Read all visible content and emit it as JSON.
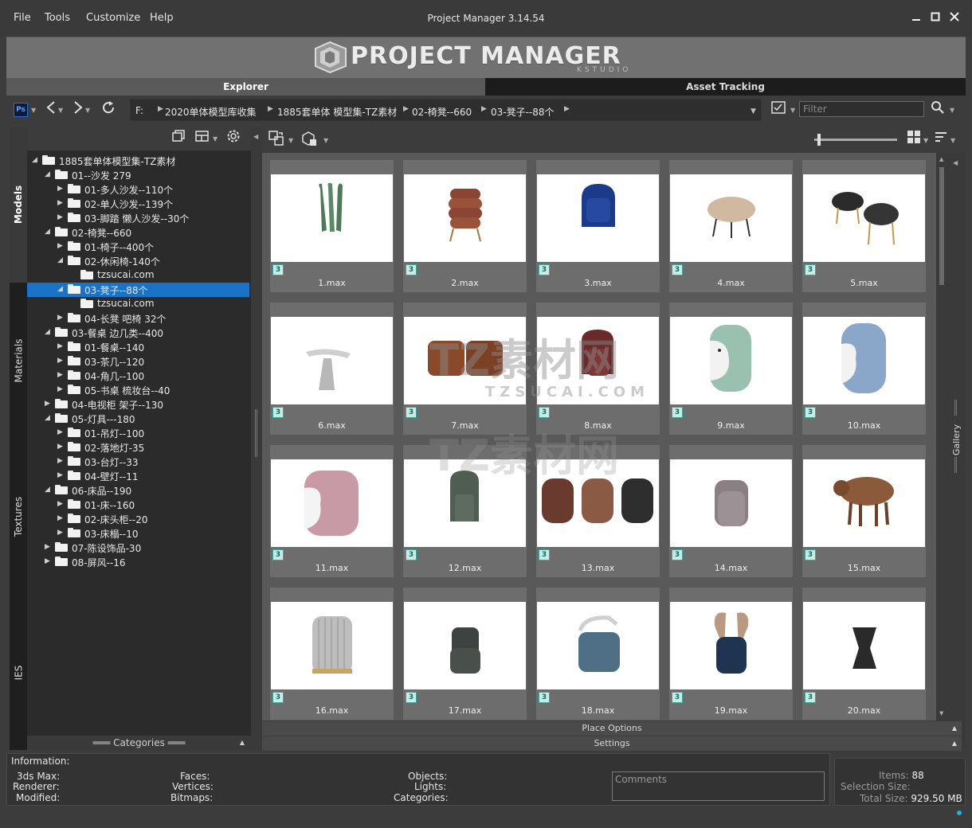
{
  "menu": [
    "File",
    "Tools",
    "Customize",
    "Help"
  ],
  "window": {
    "title": "Project Manager 3.14.54"
  },
  "banner": {
    "title": "PROJECT MANAGER",
    "subtitle": "KSTUDIO"
  },
  "tabs": {
    "explorer": "Explorer",
    "asset_tracking": "Asset Tracking"
  },
  "toolbar": {
    "ps_badge": "Ps",
    "breadcrumb": [
      "F:",
      "2020单体模型库收集",
      "1885套单体 模型集-TZ素材",
      "02-椅凳--660",
      "03-凳子--88个"
    ],
    "filter_placeholder": "Filter"
  },
  "left_tabs": [
    "Models",
    "Materials",
    "Textures",
    "IES"
  ],
  "tree": [
    {
      "label": "1885套单体模型集-TZ素材",
      "level": 0,
      "expanded": true,
      "has_children": true
    },
    {
      "label": "01--沙发 279",
      "level": 1,
      "expanded": true,
      "has_children": true
    },
    {
      "label": "01-多人沙发--110个",
      "level": 2,
      "expanded": false,
      "has_children": true
    },
    {
      "label": "02-单人沙发--139个",
      "level": 2,
      "expanded": false,
      "has_children": true
    },
    {
      "label": "03-脚踏 懒人沙发--30个",
      "level": 2,
      "expanded": false,
      "has_children": true
    },
    {
      "label": "02-椅凳--660",
      "level": 1,
      "expanded": true,
      "has_children": true
    },
    {
      "label": "01-椅子--400个",
      "level": 2,
      "expanded": false,
      "has_children": true
    },
    {
      "label": "02-休闲椅-140个",
      "level": 2,
      "expanded": true,
      "has_children": true
    },
    {
      "label": "tzsucai.com",
      "level": 3,
      "expanded": false,
      "has_children": false
    },
    {
      "label": "03-凳子--88个",
      "level": 2,
      "expanded": true,
      "has_children": true,
      "selected": true
    },
    {
      "label": "tzsucai.com",
      "level": 3,
      "expanded": false,
      "has_children": false
    },
    {
      "label": "04-长凳 吧椅 32个",
      "level": 2,
      "expanded": false,
      "has_children": true
    },
    {
      "label": "03-餐桌 边几类--400",
      "level": 1,
      "expanded": true,
      "has_children": true
    },
    {
      "label": "01-餐桌--140",
      "level": 2,
      "expanded": false,
      "has_children": true
    },
    {
      "label": "03-茶几--120",
      "level": 2,
      "expanded": false,
      "has_children": true
    },
    {
      "label": "04-角几--100",
      "level": 2,
      "expanded": false,
      "has_children": true
    },
    {
      "label": "05-书桌 梳妆台--40",
      "level": 2,
      "expanded": false,
      "has_children": true
    },
    {
      "label": "04-电视柜 架子--130",
      "level": 1,
      "expanded": false,
      "has_children": true
    },
    {
      "label": "05-灯具---180",
      "level": 1,
      "expanded": true,
      "has_children": true
    },
    {
      "label": "01-吊灯--100",
      "level": 2,
      "expanded": false,
      "has_children": true
    },
    {
      "label": "02-落地灯-35",
      "level": 2,
      "expanded": false,
      "has_children": true
    },
    {
      "label": "03-台灯--33",
      "level": 2,
      "expanded": false,
      "has_children": true
    },
    {
      "label": "04-壁灯--11",
      "level": 2,
      "expanded": false,
      "has_children": true
    },
    {
      "label": "06-床品--190",
      "level": 1,
      "expanded": true,
      "has_children": true
    },
    {
      "label": "01-床--160",
      "level": 2,
      "expanded": false,
      "has_children": true
    },
    {
      "label": "02-床头柜--20",
      "level": 2,
      "expanded": false,
      "has_children": true
    },
    {
      "label": "03-床榻--10",
      "level": 2,
      "expanded": false,
      "has_children": true
    },
    {
      "label": "07-陈设饰品-30",
      "level": 1,
      "expanded": false,
      "has_children": true
    },
    {
      "label": "08-屏风--16",
      "level": 1,
      "expanded": false,
      "has_children": true
    }
  ],
  "categories_label": "Categories",
  "gallery": {
    "side_label": "Gallery",
    "badge": "3",
    "items": [
      "1.max",
      "2.max",
      "3.max",
      "4.max",
      "5.max",
      "6.max",
      "7.max",
      "8.max",
      "9.max",
      "10.max",
      "11.max",
      "12.max",
      "13.max",
      "14.max",
      "15.max",
      "16.max",
      "17.max",
      "18.max",
      "19.max",
      "20.max"
    ]
  },
  "place_options_label": "Place Options",
  "settings_label": "Settings",
  "info": {
    "header": "Information:",
    "c1": [
      "3ds Max:",
      "Renderer:",
      "Modified:"
    ],
    "c2": [
      "Faces:",
      "Vertices:",
      "Bitmaps:"
    ],
    "c3": [
      "Objects:",
      "Lights:",
      "Categories:"
    ],
    "comments_placeholder": "Comments"
  },
  "stats": {
    "items_label": "Items:",
    "items_value": "88",
    "selection_label": "Selection Size:",
    "selection_value": "",
    "total_label": "Total Size:",
    "total_value": "929.50 MB"
  },
  "watermark": {
    "text1": "TZ素材网",
    "text2": "TZSUCAI.COM"
  },
  "colors": {
    "selected_row": "#1a73c6",
    "badge_bg": "#c9ece7",
    "badge_border": "#3aa999"
  }
}
